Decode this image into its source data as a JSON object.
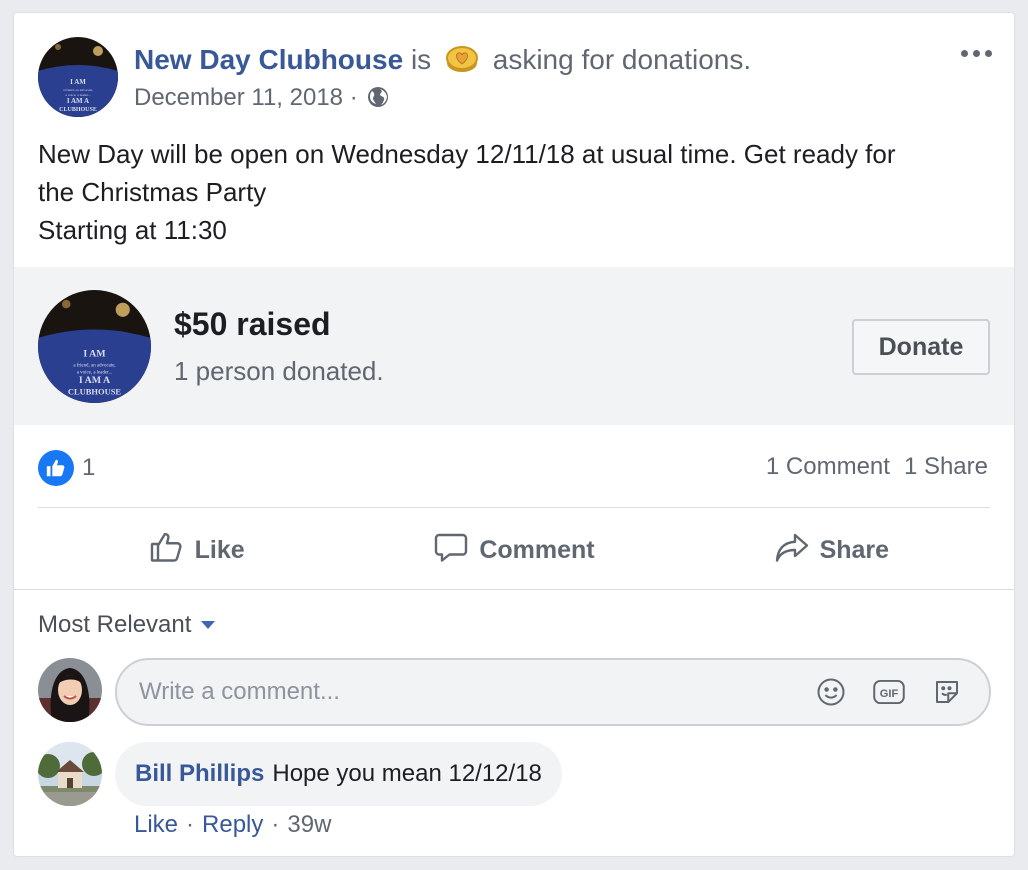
{
  "post": {
    "page_name": "New Day Clubhouse",
    "is_word": "is",
    "activity": "asking for donations.",
    "date": "December 11, 2018",
    "separator": "·",
    "text_line1": "New Day will be open on Wednesday 12/11/18 at usual time. Get ready for",
    "text_line2": "the Christmas Party",
    "text_line3": "Starting at 11:30",
    "avatar_text": [
      "I AM",
      "a friend, an advocate,",
      "a voice, a leader...",
      "I AM A",
      "CLUBHOUSE"
    ]
  },
  "fundraiser": {
    "amount": "$50 raised",
    "donor_count": "1 person donated.",
    "donate_label": "Donate"
  },
  "reactions": {
    "like_count": "1",
    "comments": "1 Comment",
    "shares": "1 Share"
  },
  "actions": {
    "like": "Like",
    "comment": "Comment",
    "share": "Share"
  },
  "comments_section": {
    "sort_label": "Most Relevant",
    "input_placeholder": "Write a comment...",
    "items": [
      {
        "author": "Bill Phillips",
        "text": "Hope you mean 12/12/18",
        "like_label": "Like",
        "reply_label": "Reply",
        "dot": "·",
        "age": "39w"
      }
    ]
  },
  "colors": {
    "link_blue": "#385898",
    "like_blue": "#1877f2",
    "muted_gray": "#606770",
    "fund_bg": "#f2f3f5",
    "shirt_blue": "#2a3f8f"
  },
  "icons": [
    "donation-coin-icon",
    "globe-icon",
    "more-options-icon",
    "like-badge-icon",
    "thumbs-up-icon",
    "comment-icon",
    "share-arrow-icon",
    "caret-down-icon",
    "emoji-icon",
    "gif-icon",
    "sticker-icon"
  ]
}
